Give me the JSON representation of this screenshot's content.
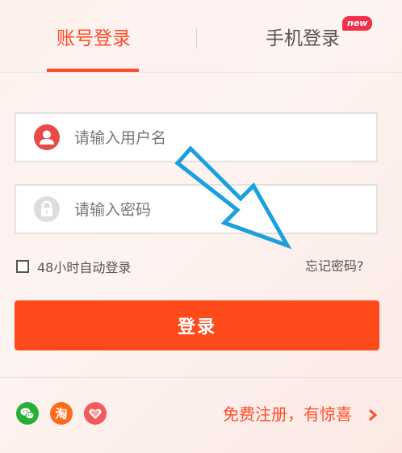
{
  "tabs": {
    "account_login": "账号登录",
    "phone_login": "手机登录",
    "new_badge": "new"
  },
  "form": {
    "username_placeholder": "请输入用户名",
    "username_value": "",
    "password_placeholder": "请输入密码",
    "password_value": "",
    "remember_label": "48小时自动登录",
    "remember_checked": false,
    "forgot_label": "忘记密码?",
    "login_button": "登录"
  },
  "footer": {
    "register_label": "免费注册，有惊喜",
    "taobao_glyph": "淘"
  },
  "icons": {
    "user": "user-icon",
    "lock": "lock-icon",
    "wechat": "wechat-icon",
    "taobao": "taobao-icon",
    "weibo": "heart-icon",
    "arrow": "chevron-right-icon"
  },
  "colors": {
    "accent": "#ff4d2a",
    "button": "#ff4a1c",
    "annotation_arrow": "#1aa0e0",
    "badge": "#f2304b",
    "wechat": "#2aae3a",
    "taobao": "#ff6a1a",
    "weibo": "#f15b5b"
  }
}
